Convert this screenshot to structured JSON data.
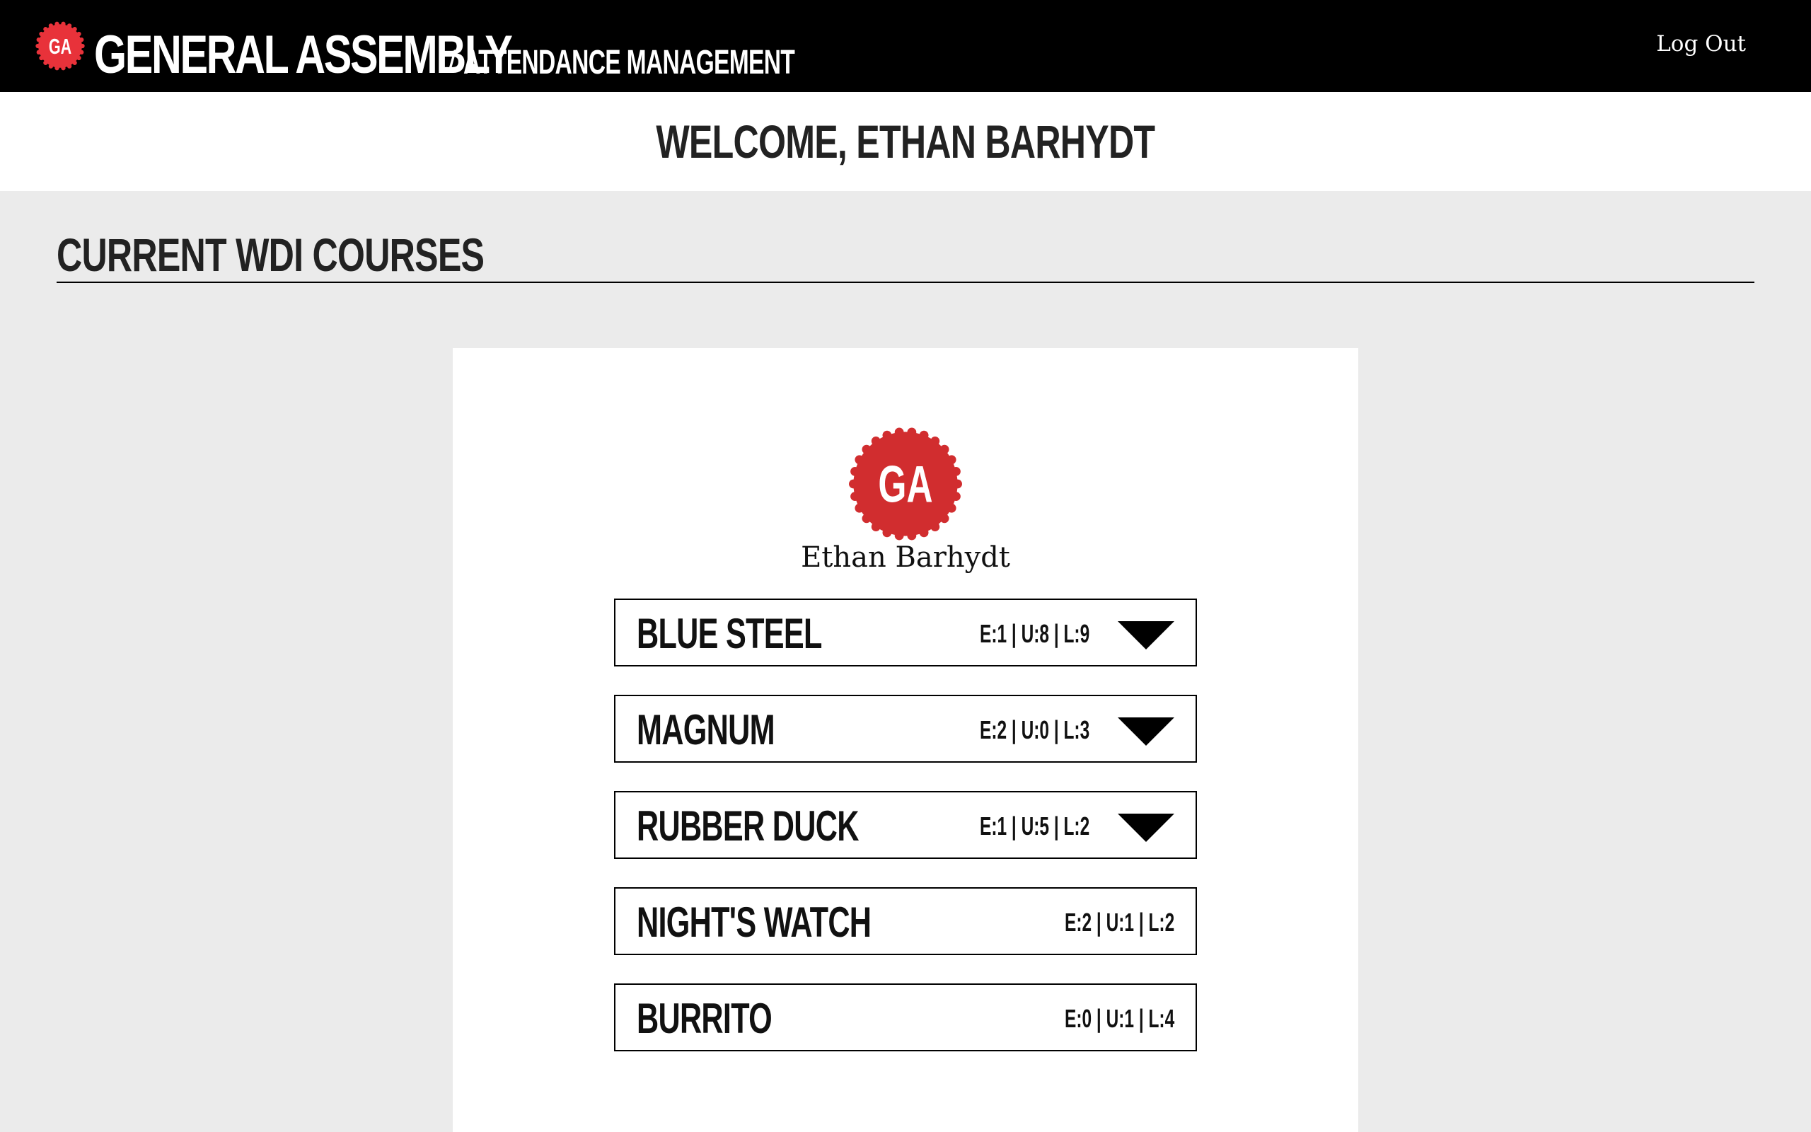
{
  "header": {
    "brand_name": "GENERAL ASSEMBLY",
    "separator": "/",
    "app_name": "ATTENDANCE MANAGEMENT",
    "logo_text": "GA",
    "logout_label": "Log Out"
  },
  "welcome": {
    "text": "WELCOME, ETHAN BARHYDT"
  },
  "section": {
    "title": "CURRENT WDI COURSES"
  },
  "profile": {
    "avatar_text": "GA",
    "name": "Ethan Barhydt"
  },
  "courses": [
    {
      "name": "BLUE STEEL",
      "stats": "E:1 | U:8 | L:9",
      "expandable": true
    },
    {
      "name": "MAGNUM",
      "stats": "E:2 | U:0 | L:3",
      "expandable": true
    },
    {
      "name": "RUBBER DUCK",
      "stats": "E:1 | U:5 | L:2",
      "expandable": true
    },
    {
      "name": "NIGHT'S WATCH",
      "stats": "E:2 | U:1 | L:2",
      "expandable": false
    },
    {
      "name": "BURRITO",
      "stats": "E:0 | U:1 | L:4",
      "expandable": false
    }
  ],
  "colors": {
    "brand_red": "#d12d2f",
    "header_bg": "#000000",
    "page_bg": "#ebebeb",
    "card_bg": "#ffffff"
  },
  "icons": {
    "logo": "ga-gear-badge-icon",
    "toggle": "triangle-down-icon"
  }
}
